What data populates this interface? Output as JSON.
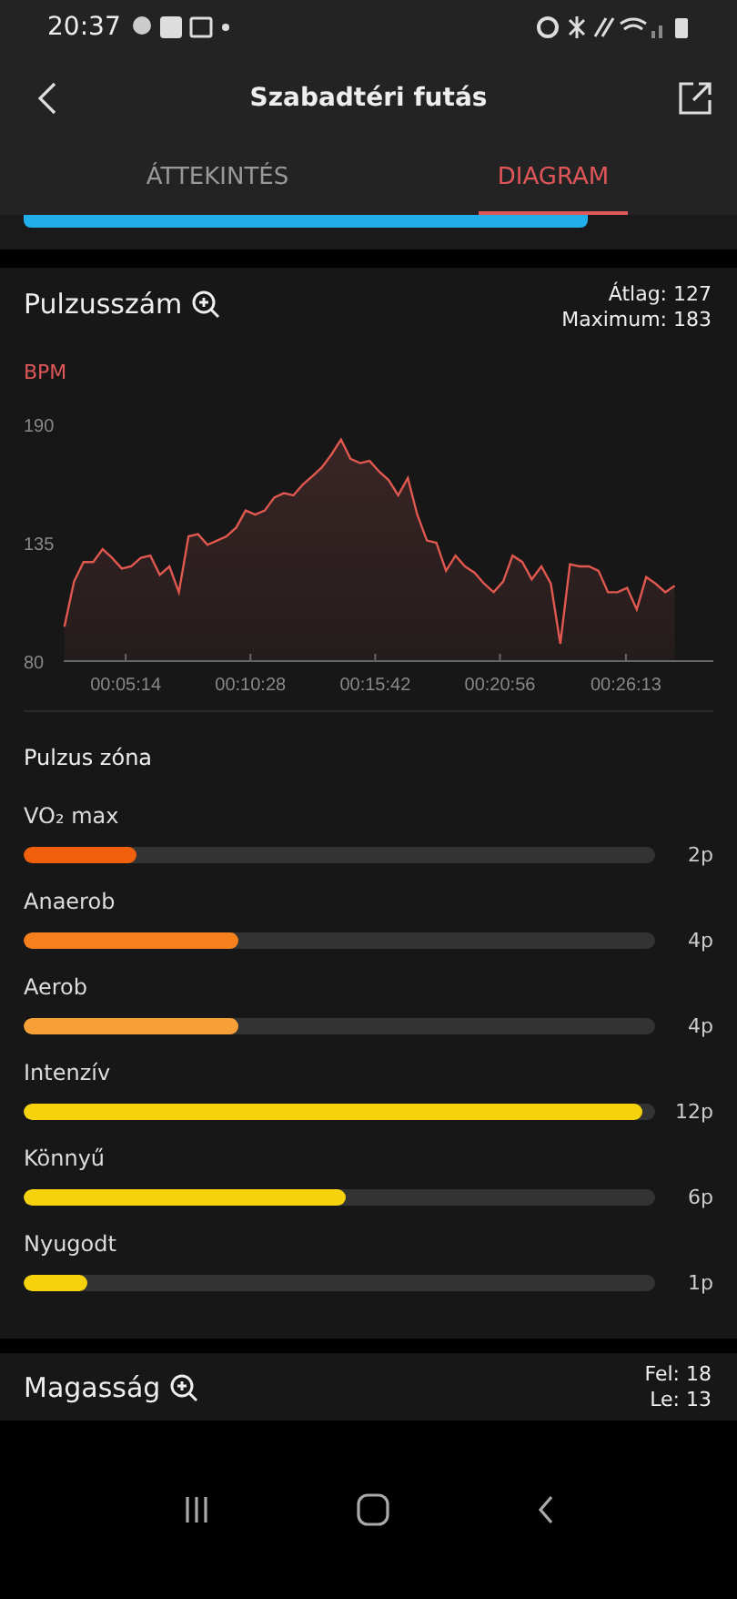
{
  "status_bar": {
    "time": "20:37"
  },
  "header": {
    "title": "Szabadtéri futás"
  },
  "tabs": [
    {
      "label": "ÁTTEKINTÉS",
      "selected": false
    },
    {
      "label": "DIAGRAM",
      "selected": true
    }
  ],
  "heart_rate": {
    "title": "Pulzusszám",
    "average": "Átlag: 127",
    "maximum": "Maximum: 183",
    "chart_data": {
      "type": "area",
      "ylabel": "BPM",
      "ylim": [
        80,
        190
      ],
      "yticks": [
        80,
        135,
        190
      ],
      "xlim": [
        158,
        1793
      ],
      "xticks": [
        {
          "value": 314,
          "label": "00:05:14"
        },
        {
          "value": 628,
          "label": "00:10:28"
        },
        {
          "value": 942,
          "label": "00:15:42"
        },
        {
          "value": 1256,
          "label": "00:20:56"
        },
        {
          "value": 1573,
          "label": "00:26:13"
        }
      ],
      "x": [
        160,
        184,
        208,
        232,
        256,
        280,
        304,
        328,
        352,
        376,
        400,
        424,
        448,
        472,
        496,
        520,
        544,
        568,
        592,
        616,
        640,
        664,
        688,
        712,
        736,
        760,
        784,
        808,
        832,
        856,
        880,
        904,
        928,
        952,
        976,
        1000,
        1024,
        1048,
        1072,
        1096,
        1120,
        1144,
        1168,
        1192,
        1216,
        1240,
        1264,
        1288,
        1312,
        1336,
        1360,
        1384,
        1408,
        1432,
        1456,
        1480,
        1504,
        1528,
        1552,
        1576,
        1600,
        1624,
        1648,
        1672,
        1696
      ],
      "series": [
        {
          "color": "#e0584f",
          "values": [
            96,
            117,
            126,
            126,
            132,
            128,
            123,
            124,
            128,
            129,
            120,
            124,
            112,
            138,
            139,
            134,
            136,
            138,
            142,
            150,
            148,
            150,
            156,
            158,
            157,
            162,
            166,
            170,
            176,
            183,
            174,
            172,
            173,
            168,
            164,
            157,
            165,
            148,
            136,
            135,
            122,
            129,
            124,
            121,
            116,
            112,
            117,
            129,
            126,
            118,
            124,
            116,
            88,
            125,
            124,
            124,
            122,
            112,
            112,
            114,
            104,
            119,
            116,
            112,
            115
          ]
        }
      ]
    }
  },
  "zones": {
    "title": "Pulzus zóna",
    "items": [
      {
        "label": "VO₂ max",
        "level": 0.18,
        "color": "#f0600c",
        "reading": "2p"
      },
      {
        "label": "Anaerob",
        "level": 0.34,
        "color": "#f5801c",
        "reading": "4p"
      },
      {
        "label": "Aerob",
        "level": 0.34,
        "color": "#f8a038",
        "reading": "4p"
      },
      {
        "label": "Intenzív",
        "level": 0.98,
        "color": "#f5d20c",
        "reading": "12p"
      },
      {
        "label": "Könnyű",
        "level": 0.51,
        "color": "#f5d20c",
        "reading": "6p"
      },
      {
        "label": "Nyugodt",
        "level": 0.1,
        "color": "#f5d20c",
        "reading": "1p"
      }
    ]
  },
  "altitude": {
    "title": "Magasság",
    "up": "Fel: 18",
    "down": "Le: 13"
  }
}
